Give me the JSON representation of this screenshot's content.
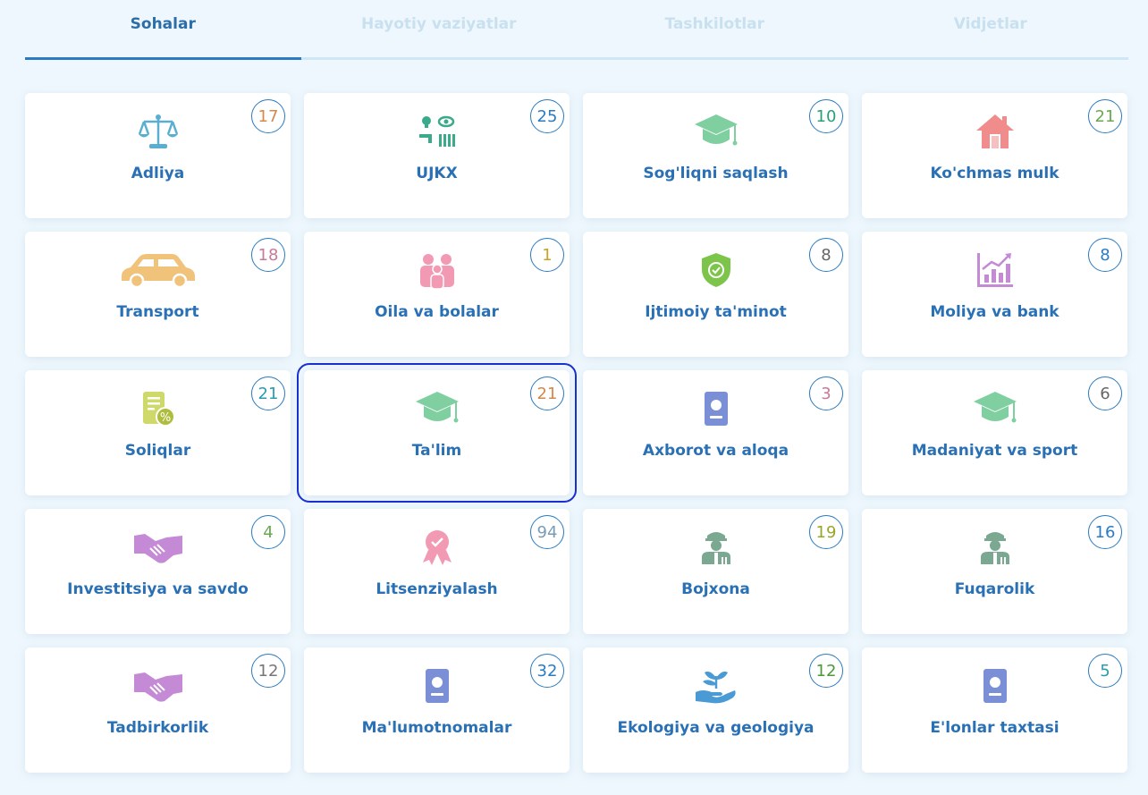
{
  "tabs": [
    {
      "label": "Sohalar",
      "active": true
    },
    {
      "label": "Hayotiy vaziyatlar",
      "active": false
    },
    {
      "label": "Tashkilotlar",
      "active": false
    },
    {
      "label": "Vidjetlar",
      "active": false
    }
  ],
  "cards": [
    {
      "label": "Adliya",
      "count": "17",
      "count_color": "#d4884a",
      "icon": "scales-icon"
    },
    {
      "label": "UJKX",
      "count": "25",
      "count_color": "#2a7bc2",
      "icon": "utilities-icon"
    },
    {
      "label": "Sog'liqni saqlash",
      "count": "10",
      "count_color": "#2aa07a",
      "icon": "graduation-cap-icon"
    },
    {
      "label": "Ko'chmas mulk",
      "count": "21",
      "count_color": "#6aa84f",
      "icon": "house-icon"
    },
    {
      "label": "Transport",
      "count": "18",
      "count_color": "#c77a9a",
      "icon": "car-icon"
    },
    {
      "label": "Oila va bolalar",
      "count": "1",
      "count_color": "#c9a227",
      "icon": "family-icon"
    },
    {
      "label": "Ijtimoiy ta'minot",
      "count": "8",
      "count_color": "#666666",
      "icon": "shield-check-icon"
    },
    {
      "label": "Moliya va bank",
      "count": "8",
      "count_color": "#2a7bc2",
      "icon": "finance-chart-icon"
    },
    {
      "label": "Soliqlar",
      "count": "21",
      "count_color": "#2a9bb0",
      "icon": "tax-document-icon"
    },
    {
      "label": "Ta'lim",
      "count": "21",
      "count_color": "#d4884a",
      "icon": "graduation-cap-icon",
      "selected": true
    },
    {
      "label": "Axborot va aloqa",
      "count": "3",
      "count_color": "#c77a9a",
      "icon": "passport-icon"
    },
    {
      "label": "Madaniyat va sport",
      "count": "6",
      "count_color": "#666666",
      "icon": "graduation-cap-icon"
    },
    {
      "label": "Investitsiya va savdo",
      "count": "4",
      "count_color": "#6aa84f",
      "icon": "handshake-icon"
    },
    {
      "label": "Litsenziyalash",
      "count": "94",
      "count_color": "#7a9bb5",
      "icon": "award-icon"
    },
    {
      "label": "Bojxona",
      "count": "19",
      "count_color": "#9aa627",
      "icon": "officer-icon"
    },
    {
      "label": "Fuqarolik",
      "count": "16",
      "count_color": "#2a7bc2",
      "icon": "officer-icon"
    },
    {
      "label": "Tadbirkorlik",
      "count": "12",
      "count_color": "#777777",
      "icon": "handshake-icon"
    },
    {
      "label": "Ma'lumotnomalar",
      "count": "32",
      "count_color": "#2a7bc2",
      "icon": "passport-icon"
    },
    {
      "label": "Ekologiya va geologiya",
      "count": "12",
      "count_color": "#4a9a3a",
      "icon": "plant-hand-icon"
    },
    {
      "label": "E'lonlar taxtasi",
      "count": "5",
      "count_color": "#2a9bb0",
      "icon": "passport-icon"
    }
  ],
  "colors": {
    "accent": "#2a7bc2",
    "label": "#2a70b5",
    "selection": "#1a2fd1"
  }
}
